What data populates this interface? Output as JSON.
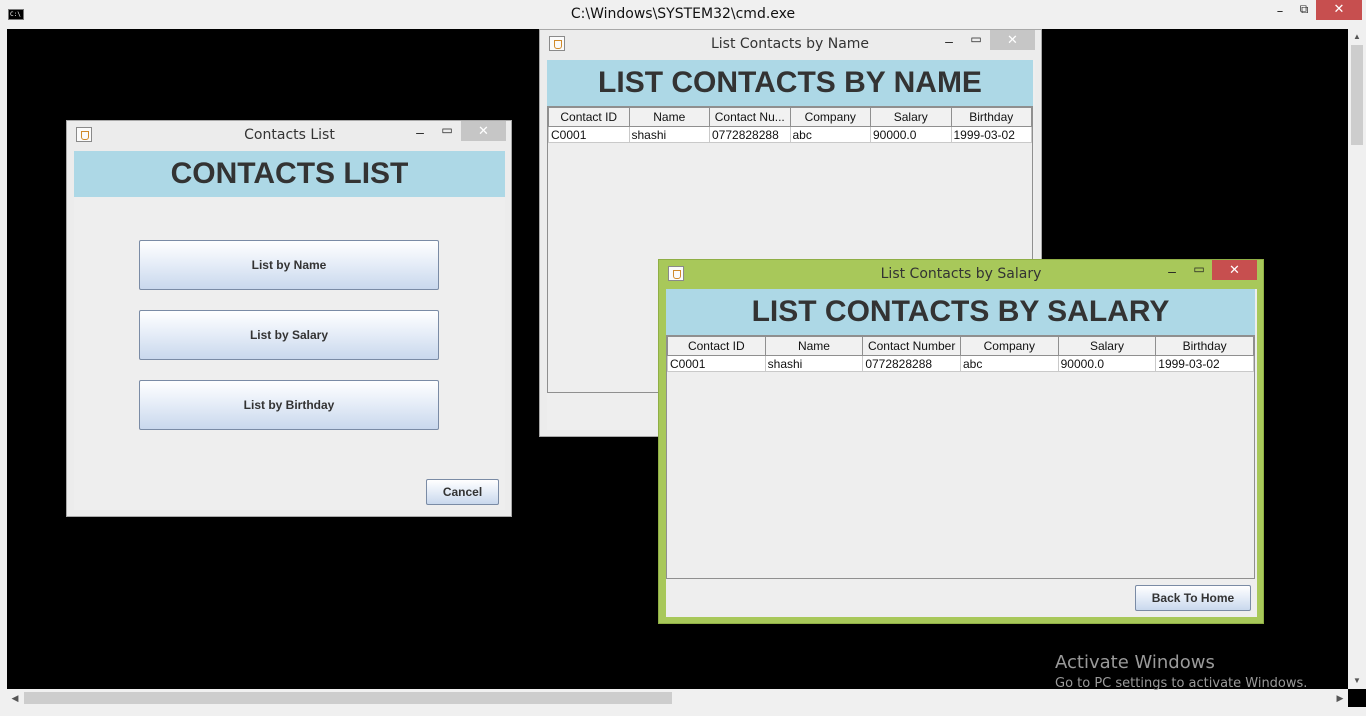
{
  "cmd": {
    "title": "C:\\Windows\\SYSTEM32\\cmd.exe",
    "icon": "cmd-icon",
    "minimize": "–",
    "maximize": "⧉",
    "close": "✕"
  },
  "contacts_list": {
    "title": "Contacts List",
    "header": "CONTACTS LIST",
    "buttons": {
      "list_by_name": "List by Name",
      "list_by_salary": "List by Salary",
      "list_by_birthday": "List by Birthday",
      "cancel": "Cancel"
    }
  },
  "by_name": {
    "title": "List Contacts by Name",
    "header": "LIST CONTACTS BY NAME",
    "columns": [
      "Contact ID",
      "Name",
      "Contact Nu...",
      "Company",
      "Salary",
      "Birthday"
    ],
    "rows": [
      [
        "C0001",
        "shashi",
        "0772828288",
        "abc",
        "90000.0",
        "1999-03-02"
      ]
    ]
  },
  "by_salary": {
    "title": "List Contacts by Salary",
    "header": "LIST CONTACTS BY SALARY",
    "columns": [
      "Contact ID",
      "Name",
      "Contact Number",
      "Company",
      "Salary",
      "Birthday"
    ],
    "rows": [
      [
        "C0001",
        "shashi",
        "0772828288",
        "abc",
        "90000.0",
        "1999-03-02"
      ]
    ],
    "back_button": "Back To Home"
  },
  "window_controls": {
    "minimize": "–",
    "maximize": "▭",
    "close": "✕"
  },
  "watermark": {
    "line1": "Activate Windows",
    "line2": "Go to PC settings to activate Windows."
  },
  "colors": {
    "header_bg": "#add8e6",
    "active_frame": "#a8c85a",
    "close_active": "#c74f4f"
  }
}
